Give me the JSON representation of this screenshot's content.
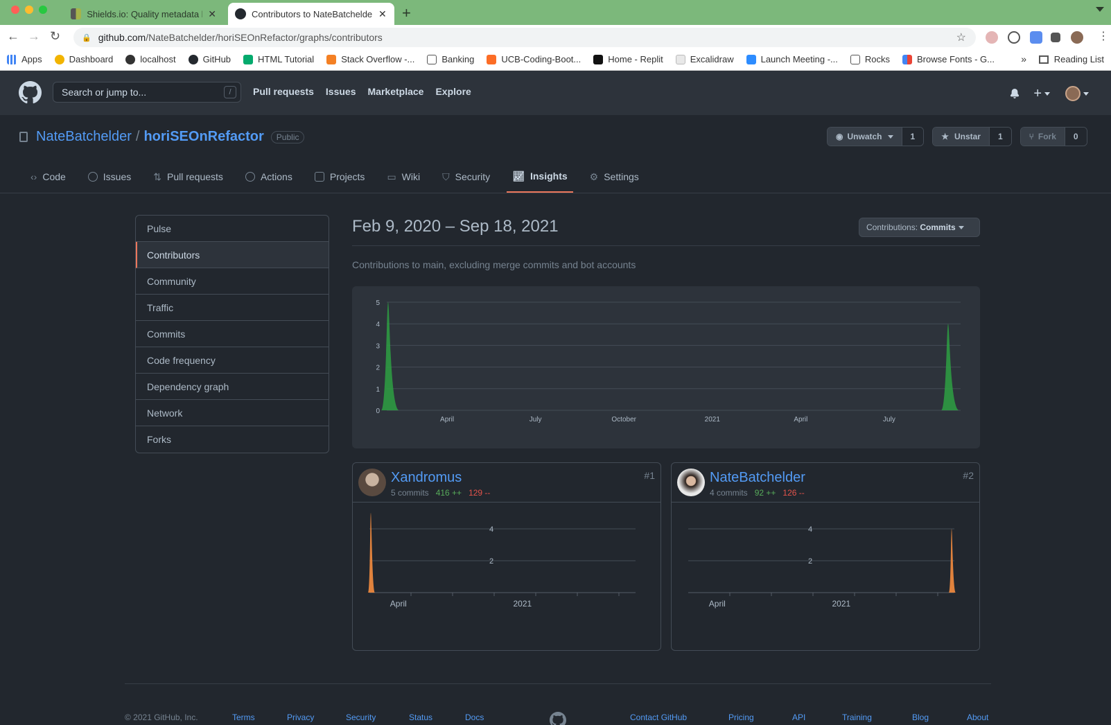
{
  "browser": {
    "tabs": [
      {
        "title": "Shields.io: Quality metadata ba",
        "active": false
      },
      {
        "title": "Contributors to NateBatchelde",
        "active": true
      }
    ],
    "url_host": "github.com",
    "url_path": "/NateBatchelder/horiSEOnRefactor/graphs/contributors",
    "bookmarks": [
      "Apps",
      "Dashboard",
      "localhost",
      "GitHub",
      "HTML Tutorial",
      "Stack Overflow -...",
      "Banking",
      "UCB-Coding-Boot...",
      "Home - Replit",
      "Excalidraw",
      "Launch Meeting -...",
      "Rocks",
      "Browse Fonts - G..."
    ],
    "bookmarks_more": "»",
    "reading_list": "Reading List"
  },
  "github": {
    "search_placeholder": "Search or jump to...",
    "search_key": "/",
    "nav": [
      "Pull requests",
      "Issues",
      "Marketplace",
      "Explore"
    ]
  },
  "repo": {
    "owner": "NateBatchelder",
    "separator": "/",
    "name": "horiSEOnRefactor",
    "visibility": "Public",
    "watch_label": "Unwatch",
    "watch_count": "1",
    "star_label": "Unstar",
    "star_count": "1",
    "fork_label": "Fork",
    "fork_count": "0",
    "tabs": [
      "Code",
      "Issues",
      "Pull requests",
      "Actions",
      "Projects",
      "Wiki",
      "Security",
      "Insights",
      "Settings"
    ],
    "active_tab": "Insights"
  },
  "insights_menu": {
    "items": [
      "Pulse",
      "Contributors",
      "Community",
      "Traffic",
      "Commits",
      "Code frequency",
      "Dependency graph",
      "Network",
      "Forks"
    ],
    "selected": "Contributors"
  },
  "main": {
    "date_range": "Feb 9, 2020 – Sep 18, 2021",
    "contrib_label": "Contributions:",
    "contrib_value": "Commits",
    "subtitle": "Contributions to main, excluding merge commits and bot accounts"
  },
  "chart_data": [
    {
      "type": "area",
      "x_tick_labels": [
        "April",
        "July",
        "October",
        "2021",
        "April",
        "July"
      ],
      "y_ticks": [
        0,
        1,
        2,
        3,
        4,
        5
      ],
      "ylim": [
        0,
        5
      ],
      "series": [
        {
          "values": [
            {
              "x": "2020-02",
              "y": 5
            },
            {
              "x": "2021-09",
              "y": 4
            }
          ]
        }
      ],
      "color": "#2ea043"
    },
    {
      "type": "area",
      "x_tick_labels": [
        "April",
        "2021"
      ],
      "y_ticks": [
        2,
        4
      ],
      "series": [
        {
          "name": "Xandromus",
          "values": [
            {
              "x": "2020-02",
              "y": 5
            }
          ]
        }
      ],
      "color": "#e0823d"
    },
    {
      "type": "area",
      "x_tick_labels": [
        "April",
        "2021"
      ],
      "y_ticks": [
        2,
        4
      ],
      "series": [
        {
          "name": "NateBatchelder",
          "values": [
            {
              "x": "2021-09",
              "y": 4
            }
          ]
        }
      ],
      "color": "#e0823d"
    }
  ],
  "contributors": [
    {
      "name": "Xandromus",
      "commits": "5 commits",
      "additions": "416 ++",
      "deletions": "129 --",
      "rank": "#1"
    },
    {
      "name": "NateBatchelder",
      "commits": "4 commits",
      "additions": "92 ++",
      "deletions": "126 --",
      "rank": "#2"
    }
  ],
  "footer": {
    "copyright": "© 2021 GitHub, Inc.",
    "links": [
      "Terms",
      "Privacy",
      "Security",
      "Status",
      "Docs",
      "Contact GitHub",
      "Pricing",
      "API",
      "Training",
      "Blog",
      "About"
    ]
  },
  "colors": {
    "accent": "#ec775c",
    "link": "#539bf5",
    "bg": "#22272e",
    "green": "#57ab5a",
    "red": "#e5534b"
  }
}
